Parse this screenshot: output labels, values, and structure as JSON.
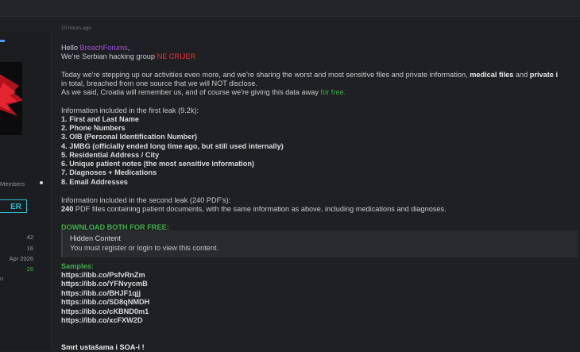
{
  "post": {
    "timestamp": "10 hours ago",
    "greeting_prefix": "Hello ",
    "greeting_name": "BreachForums",
    "greeting_suffix": ",",
    "intro_prefix": "We're Serbian hacking group ",
    "group_name": "NE CRIJER",
    "para1_line1_prefix": "Today we're stepping up our activities even more, and we're sharing the worst and most sensitive files and private information, ",
    "para1_line1_bold1": "medical files",
    "para1_line1_mid": " and ",
    "para1_line1_bold2": "private i",
    "para1_line2": "in total, breached from one source that we will NOT disclose.",
    "para1_line3_prefix": "As we said, Croatia will remember us, and of course we're giving this data away ",
    "para1_line3_green": "for free.",
    "leak1_heading": "Information included in the first leak (9.2k):",
    "leak1_items": [
      "1. First and Last Name",
      "2. Phone Numbers",
      "3. OIB (Personal Identification Number)",
      "4. JMBG (officially ended long time ago, but still used internally)",
      "5. Residential Address / City",
      "6. Unique patient notes (the most sensitive information)",
      "7. Diagnoses + Medications",
      "8. Email Addresses"
    ],
    "leak2_heading": "Information included in the second leak (240 PDF's):",
    "leak2_count": "240",
    "leak2_text": " PDF files containing patient documents, with the same information as above, including medications and diagnoses.",
    "download_label": "DOWNLOAD BOTH FOR FREE:",
    "hidden_title": "Hidden Content",
    "hidden_text": "You must register or login to view this content.",
    "samples_label": "Samples:",
    "sample_links": [
      "https://ibb.co/PsfvRnZm",
      "https://ibb.co/YFNvycmB",
      "https://ibb.co/BHJF1qjj",
      "https://ibb.co/SD8qNMDH",
      "https://ibb.co/cKBND0m1",
      "https://ibb.co/xcFXW2D"
    ],
    "closing": "Smrt ustašama i SOA-i !"
  },
  "sidebar": {
    "members_label": "Members",
    "rank_label": "ER",
    "stats": [
      "42",
      "16",
      "Apr 2026",
      "28"
    ],
    "last_label": "n"
  },
  "colors": {
    "accent_purple": "#a24fd4",
    "accent_red": "#e5353e",
    "accent_green": "#3fae4b",
    "rank_cyan": "#2ec1d6"
  }
}
